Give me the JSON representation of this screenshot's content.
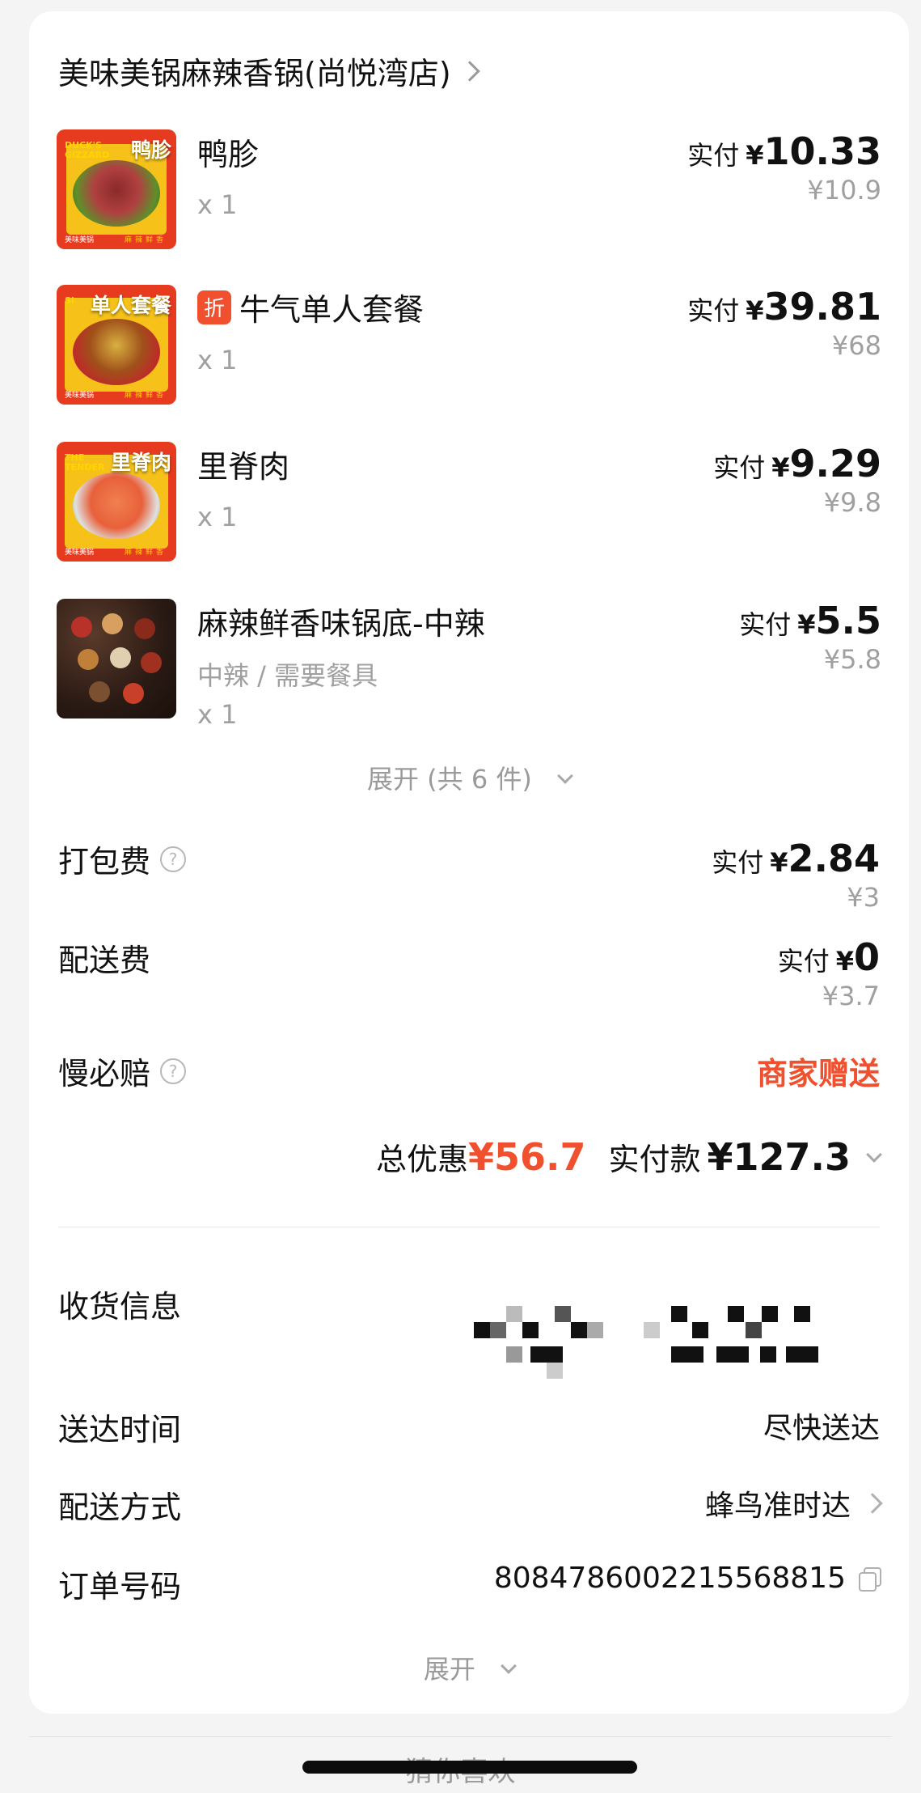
{
  "store": {
    "name": "美味美锅麻辣香锅(尚悦湾店)"
  },
  "items": [
    {
      "name": "鸭胗",
      "discount_badge": "",
      "spec": "",
      "qty": "x 1",
      "paid_label": "实付",
      "currency": "¥",
      "paid_amount": "10.33",
      "original_price": "¥10.9",
      "thumb_label": "鸭胗",
      "thumb_en": "DUCK'S GIZZARD",
      "thumb_brand": "美味美锅",
      "thumb_tag": "麻辣鲜香"
    },
    {
      "name": "牛气单人套餐",
      "discount_badge": "折",
      "spec": "",
      "qty": "x 1",
      "paid_label": "实付",
      "currency": "¥",
      "paid_amount": "39.81",
      "original_price": "¥68",
      "thumb_label": "单人套餐",
      "thumb_en": "SI",
      "thumb_brand": "美味美锅",
      "thumb_tag": "麻辣鲜香"
    },
    {
      "name": "里脊肉",
      "discount_badge": "",
      "spec": "",
      "qty": "x 1",
      "paid_label": "实付",
      "currency": "¥",
      "paid_amount": "9.29",
      "original_price": "¥9.8",
      "thumb_label": "里脊肉",
      "thumb_en": "THE TENDER",
      "thumb_brand": "美味美锅",
      "thumb_tag": "麻辣鲜香"
    },
    {
      "name": "麻辣鲜香味锅底-中辣",
      "discount_badge": "",
      "spec": "中辣 / 需要餐具",
      "qty": "x 1",
      "paid_label": "实付",
      "currency": "¥",
      "paid_amount": "5.5",
      "original_price": "¥5.8"
    }
  ],
  "expand_items": "展开 (共 6 件)",
  "fees": {
    "packing": {
      "label": "打包费",
      "paid_label": "实付",
      "currency": "¥",
      "paid_amount": "2.84",
      "original_price": "¥3"
    },
    "delivery": {
      "label": "配送费",
      "paid_label": "实付",
      "currency": "¥",
      "paid_amount": "0",
      "original_price": "¥3.7"
    },
    "late_comp": {
      "label": "慢必赔",
      "value": "商家赠送"
    }
  },
  "summary": {
    "discount_label": "总优惠",
    "discount_value": "¥56.7",
    "total_label": "实付款",
    "total_value": "¥127.3"
  },
  "info": {
    "address_label": "收货信息",
    "time_label": "送达时间",
    "time_value": "尽快送达",
    "method_label": "配送方式",
    "method_value": "蜂鸟准时达",
    "order_label": "订单号码",
    "order_value": "8084786002215568815"
  },
  "expand_info": "展开",
  "bottom_title": "猜你喜欢",
  "colors": {
    "accent": "#f0502d",
    "muted": "#a0a0a0"
  }
}
